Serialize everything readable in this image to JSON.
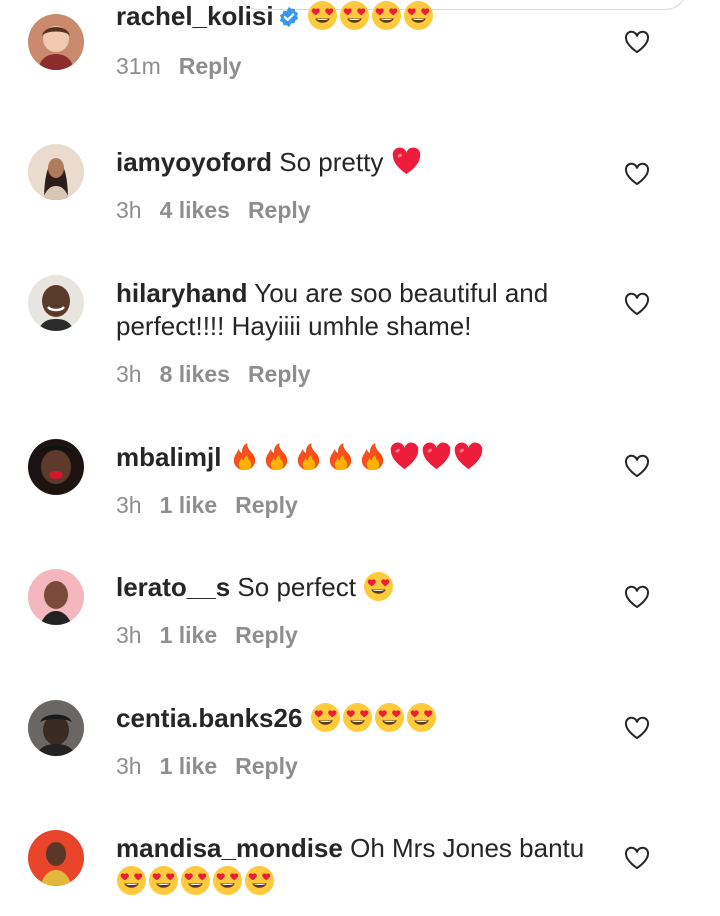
{
  "top_input": {
    "placeholder": ""
  },
  "comments": [
    {
      "username": "rachel_kolisi",
      "verified": true,
      "message": "",
      "emojis": [
        "heart-eyes",
        "heart-eyes",
        "heart-eyes",
        "heart-eyes"
      ],
      "time": "31m",
      "likes": "",
      "reply": "Reply",
      "avatar_color": "#c98a6e"
    },
    {
      "username": "iamyoyoford",
      "verified": false,
      "message": "So pretty",
      "emojis": [
        "red-heart"
      ],
      "time": "3h",
      "likes": "4 likes",
      "reply": "Reply",
      "avatar_color": "#d8c2b3"
    },
    {
      "username": "hilaryhand",
      "verified": false,
      "message": "You are soo beautiful and perfect!!!! Hayiiii umhle shame!",
      "emojis": [],
      "time": "3h",
      "likes": "8 likes",
      "reply": "Reply",
      "avatar_color": "#6f5a4a"
    },
    {
      "username": "mbalimjl",
      "verified": false,
      "message": "",
      "emojis": [
        "fire",
        "fire",
        "fire",
        "fire",
        "fire",
        "red-heart",
        "red-heart",
        "red-heart"
      ],
      "time": "3h",
      "likes": "1 like",
      "reply": "Reply",
      "avatar_color": "#3b2a24"
    },
    {
      "username": "lerato__s",
      "verified": false,
      "message": "So perfect",
      "emojis": [
        "heart-eyes"
      ],
      "time": "3h",
      "likes": "1 like",
      "reply": "Reply",
      "avatar_color": "#f2a8b0"
    },
    {
      "username": "centia.banks26",
      "verified": false,
      "message": "",
      "emojis": [
        "heart-eyes",
        "heart-eyes",
        "heart-eyes",
        "heart-eyes"
      ],
      "time": "3h",
      "likes": "1 like",
      "reply": "Reply",
      "avatar_color": "#4d4a48"
    },
    {
      "username": "mandisa_mondise",
      "verified": false,
      "message": "Oh Mrs Jones bantu",
      "emojis": [
        "heart-eyes",
        "heart-eyes",
        "heart-eyes",
        "heart-eyes",
        "heart-eyes"
      ],
      "time": "",
      "likes": "",
      "reply": "",
      "avatar_color": "#e04a2c"
    }
  ],
  "colors": {
    "text": "#262626",
    "meta": "#8e8e8e",
    "border": "#dbdbdb",
    "verified": "#3897f0",
    "heart_red": "#ed1c3a",
    "emoji_yellow": "#ffcb3d"
  }
}
